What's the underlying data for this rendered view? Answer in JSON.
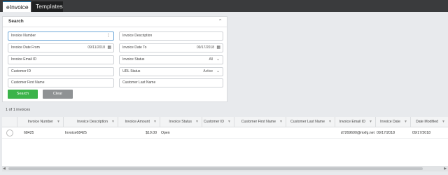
{
  "tabs": [
    {
      "label": "eInvoice",
      "active": true
    },
    {
      "label": "Templates",
      "active": false
    }
  ],
  "search_panel": {
    "title": "Search",
    "collapse_icon": "chevron-up-icon",
    "invoice_number": {
      "placeholder": "Invoice Number",
      "icon": "more-vert-icon"
    },
    "invoice_description": {
      "placeholder": "Invoice Description"
    },
    "invoice_date_from": {
      "label": "Invoice Date From",
      "value": "09/11/2018",
      "icon": "calendar-icon"
    },
    "invoice_date_to": {
      "label": "Invoice Date To",
      "value": "09/17/2018",
      "icon": "calendar-icon"
    },
    "invoice_email_id": {
      "placeholder": "Invoice Email ID"
    },
    "invoice_status": {
      "label": "Invoice Status",
      "value": "All",
      "icon": "chevron-down-icon"
    },
    "customer_id": {
      "placeholder": "Customer ID"
    },
    "url_status": {
      "label": "URL Status",
      "value": "Active",
      "icon": "chevron-down-icon"
    },
    "customer_first_name": {
      "placeholder": "Customer First Name"
    },
    "customer_last_name": {
      "placeholder": "Customer Last Name"
    },
    "search_label": "Search",
    "clear_label": "Clear"
  },
  "results": {
    "count_text": "1 of 1 invoices",
    "columns": [
      "Invoice Number",
      "Invoice Description",
      "Invoice Amount",
      "Invoice Status",
      "Customer ID",
      "Customer First Name",
      "Customer Last Name",
      "Invoice Email ID",
      "Invoice Date",
      "Date Modified"
    ],
    "rows": [
      {
        "invoice_number": "68425",
        "invoice_description": "Invoice68425",
        "invoice_amount": "$10.00",
        "invoice_status": "Open",
        "customer_id": "",
        "customer_first_name": "",
        "customer_last_name": "",
        "invoice_email_id": "d7269600@mxfg.net",
        "invoice_date": "09/17/2018",
        "date_modified": "09/17/2018"
      }
    ]
  },
  "colors": {
    "topbar": "#3a3b3d",
    "search_button": "#3bb34a",
    "clear_button": "#8f9294"
  }
}
